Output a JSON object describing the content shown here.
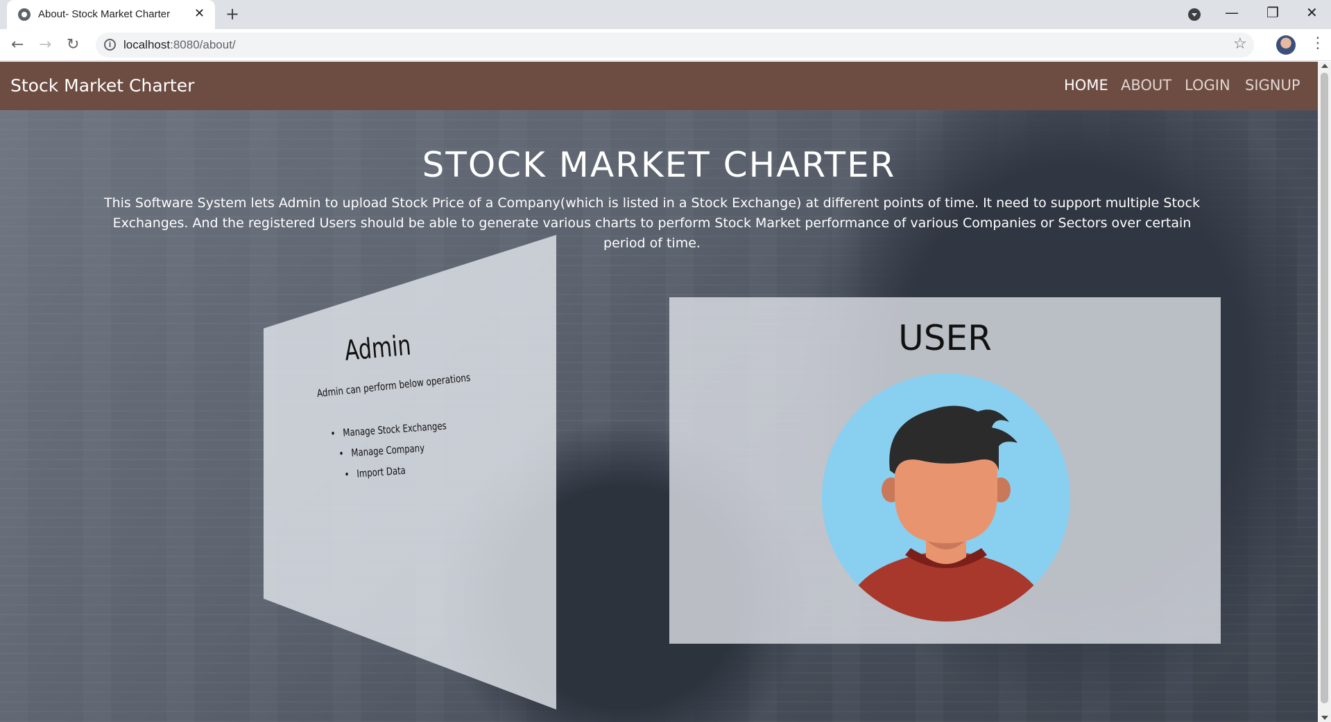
{
  "browser": {
    "tab_title": "About- Stock Market Charter",
    "tab_close": "✕",
    "new_tab": "+",
    "url_host": "localhost",
    "url_path": ":8080/about/",
    "back": "←",
    "forward": "→",
    "reload": "↻",
    "minimize": "—",
    "restore": "❐",
    "close": "✕",
    "star": "☆",
    "menu": "⋮",
    "info": "i"
  },
  "nav": {
    "brand": "Stock Market Charter",
    "links": [
      "HOME",
      "ABOUT",
      "LOGIN",
      "SIGNUP"
    ]
  },
  "hero": {
    "title": "STOCK MARKET CHARTER",
    "description": "This Software System lets Admin to upload Stock Price of a Company(which is listed in a Stock Exchange) at different points of time. It need to support multiple Stock Exchanges. And the registered Users should be able to generate various charts to perform Stock Market performance of various Companies or Sectors over certain period of time."
  },
  "admin": {
    "title": "Admin",
    "subtitle": "Admin can perform below operations",
    "items": [
      "Manage Stock Exchanges",
      "Manage Company",
      "Import Data"
    ]
  },
  "user": {
    "title": "USER"
  },
  "colors": {
    "navbar": "#6d4c41",
    "avatar_bg": "#89cff0",
    "avatar_shirt": "#a8382c",
    "avatar_skin": "#e8956f",
    "avatar_hair": "#2b2b2b"
  }
}
